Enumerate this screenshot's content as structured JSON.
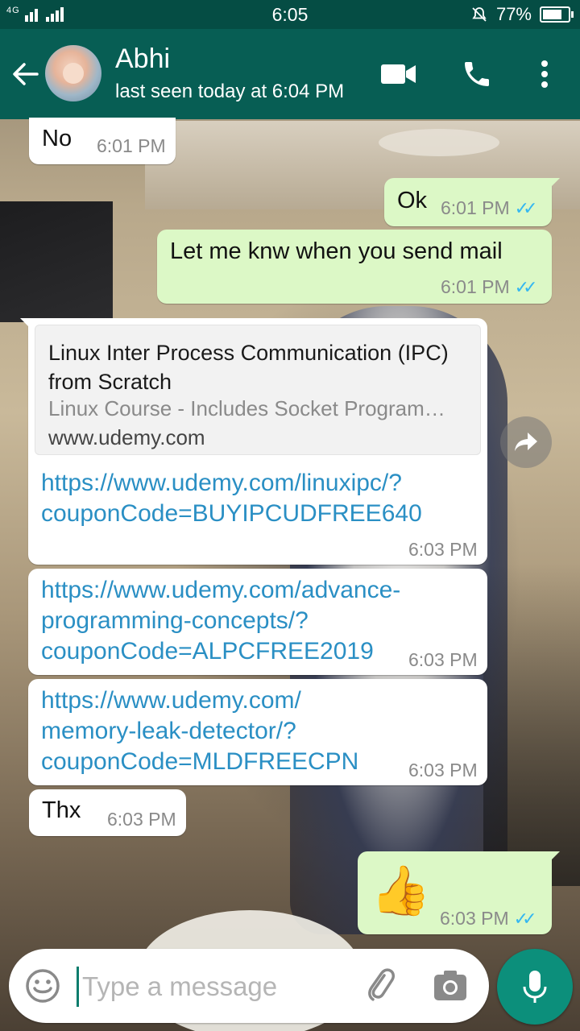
{
  "status_bar": {
    "network": "4G",
    "time": "6:05",
    "battery": "77%",
    "battery_level": 0.77
  },
  "header": {
    "contact_name": "Abhi",
    "last_seen": "last seen today at 6:04 PM",
    "icons": [
      "back-arrow-icon",
      "video-call-icon",
      "phone-icon",
      "more-vert-icon"
    ]
  },
  "messages": [
    {
      "direction": "in",
      "text": "No",
      "time": "6:01 PM"
    },
    {
      "direction": "out",
      "text": "Ok",
      "time": "6:01 PM",
      "status": "read"
    },
    {
      "direction": "out",
      "text": "Let me knw when you send mail",
      "time": "6:01 PM",
      "status": "read"
    },
    {
      "direction": "in",
      "preview": {
        "title": "Linux Inter Process Communication (IPC) from Scratch",
        "description": "Linux Course - Includes Socket Program…",
        "domain": "www.udemy.com"
      },
      "link_line1": "https://www.udemy.com/linuxipc/?",
      "link_line2": "couponCode=BUYIPCUDFREE640",
      "time": "6:03 PM"
    },
    {
      "direction": "in",
      "link_line1": "https://www.udemy.com/advance-",
      "link_line2": "programming-concepts/?",
      "link_line3": "couponCode=ALPCFREE2019",
      "time": "6:03 PM"
    },
    {
      "direction": "in",
      "link_line1": "https://www.udemy.com/",
      "link_line2": "memory-leak-detector/?",
      "link_line3": "couponCode=MLDFREECPN",
      "time": "6:03 PM"
    },
    {
      "direction": "in",
      "text": "Thx",
      "time": "6:03 PM"
    },
    {
      "direction": "out",
      "text": "👍",
      "time": "6:03 PM",
      "status": "read"
    }
  ],
  "input": {
    "placeholder": "Type a message",
    "value": ""
  },
  "colors": {
    "header": "#075e54",
    "status_bar": "#054d44",
    "outgoing_bubble": "#dcf8c6",
    "incoming_bubble": "#ffffff",
    "link": "#2a8fc4",
    "read_ticks": "#34b7f1",
    "mic_button": "#0c8f7b"
  }
}
